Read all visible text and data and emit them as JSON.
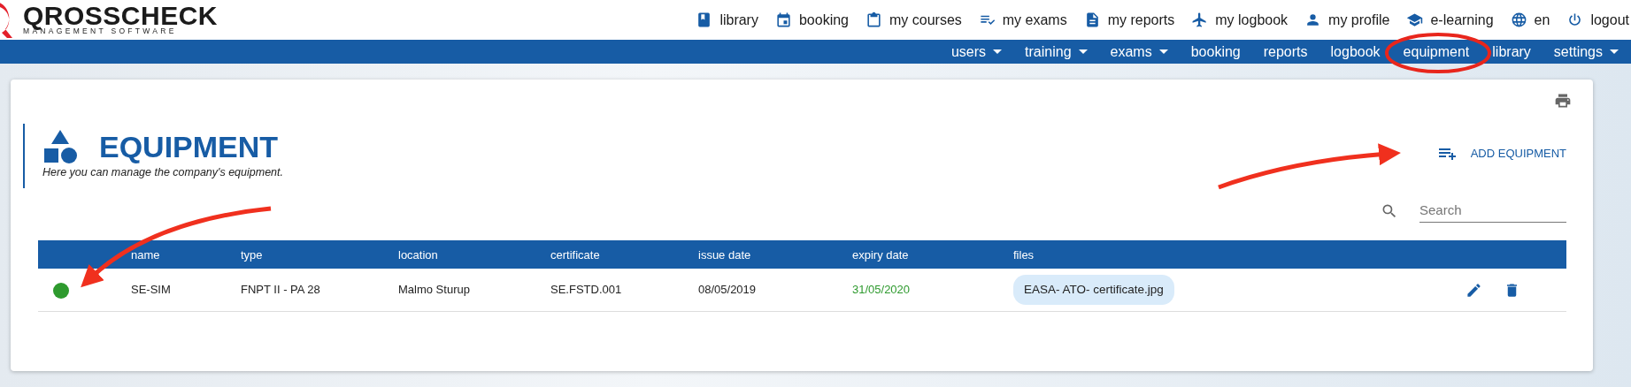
{
  "logo": {
    "name": "QROSSCHECK",
    "tagline": "MANAGEMENT SOFTWARE"
  },
  "top_links": [
    {
      "kind": "book",
      "label": "library"
    },
    {
      "kind": "calendar",
      "label": "booking"
    },
    {
      "kind": "clipboard",
      "label": "my courses"
    },
    {
      "kind": "checklist",
      "label": "my exams"
    },
    {
      "kind": "document",
      "label": "my reports"
    },
    {
      "kind": "airplane",
      "label": "my logbook"
    },
    {
      "kind": "person",
      "label": "my profile"
    },
    {
      "kind": "cap",
      "label": "e-learning"
    },
    {
      "kind": "globe",
      "label": "en"
    },
    {
      "kind": "power",
      "label": "logout"
    }
  ],
  "nav_items": [
    {
      "label": "users",
      "dropdown": true
    },
    {
      "label": "training",
      "dropdown": true
    },
    {
      "label": "exams",
      "dropdown": true
    },
    {
      "label": "booking",
      "dropdown": false
    },
    {
      "label": "reports",
      "dropdown": false
    },
    {
      "label": "logbook",
      "dropdown": false
    },
    {
      "label": "equipment",
      "dropdown": false
    },
    {
      "label": "library",
      "dropdown": false
    },
    {
      "label": "settings",
      "dropdown": true
    }
  ],
  "page": {
    "title": "EQUIPMENT",
    "subtitle": "Here you can manage the company's equipment.",
    "add_button": "ADD EQUIPMENT",
    "search": {
      "placeholder": "Search"
    }
  },
  "table": {
    "columns": [
      "name",
      "type",
      "location",
      "certificate",
      "issue date",
      "expiry date",
      "files"
    ],
    "rows": [
      {
        "color": "#2e9a2e",
        "cells": [
          "SE-SIM",
          "FNPT II - PA 28",
          "Malmo Sturup",
          "SE.FSTD.001",
          "08/05/2019",
          "31/05/2020"
        ],
        "files": [
          "EASA- ATO- certificate.jpg"
        ]
      }
    ]
  }
}
